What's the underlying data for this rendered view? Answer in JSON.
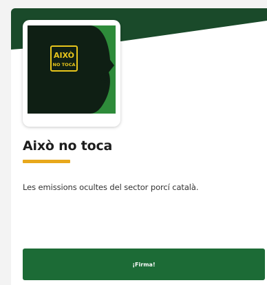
{
  "card": {
    "title": "Això no toca",
    "description": "Les emissions ocultes del sector porcí català.",
    "cta_label": "¡Firma!",
    "thumbnail": {
      "logo_line1": "AIXÒ",
      "logo_line2": "NO TOCA"
    }
  },
  "colors": {
    "brand_green": "#1c6b36",
    "header_green": "#1a4a2a",
    "accent_yellow": "#e8a81c"
  }
}
